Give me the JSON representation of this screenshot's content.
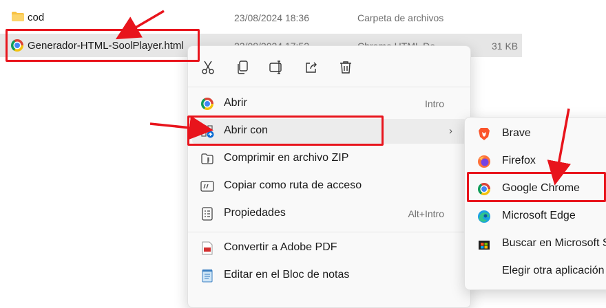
{
  "files": [
    {
      "name": "cod",
      "date": "23/08/2024 18:36",
      "type": "Carpeta de archivos",
      "size": ""
    },
    {
      "name": "Generador-HTML-SoolPlayer.html",
      "date": "23/08/2024 17:52",
      "type": "Chrome HTML Do",
      "size": "31 KB"
    }
  ],
  "context_menu": {
    "toolbar_icons": [
      "cut-icon",
      "copy-icon",
      "rename-icon",
      "share-icon",
      "delete-icon"
    ],
    "items": [
      {
        "label": "Abrir",
        "shortcut": "Intro",
        "icon": "chrome-icon"
      },
      {
        "label": "Abrir con",
        "shortcut": "",
        "icon": "open-with-icon"
      },
      {
        "label": "Comprimir en archivo ZIP",
        "shortcut": "",
        "icon": "zip-icon"
      },
      {
        "label": "Copiar como ruta de acceso",
        "shortcut": "",
        "icon": "path-icon"
      },
      {
        "label": "Propiedades",
        "shortcut": "Alt+Intro",
        "icon": "properties-icon"
      },
      {
        "label": "Convertir a Adobe PDF",
        "shortcut": "",
        "icon": "pdf-icon"
      },
      {
        "label": "Editar en el Bloc de notas",
        "shortcut": "",
        "icon": "notepad-icon"
      }
    ]
  },
  "submenu": {
    "items": [
      {
        "label": "Brave",
        "icon": "brave-icon"
      },
      {
        "label": "Firefox",
        "icon": "firefox-icon"
      },
      {
        "label": "Google Chrome",
        "icon": "chrome-icon"
      },
      {
        "label": "Microsoft Edge",
        "icon": "edge-icon"
      },
      {
        "label": "Buscar en Microsoft Store",
        "icon": "store-icon"
      },
      {
        "label": "Elegir otra aplicación",
        "icon": ""
      }
    ]
  },
  "colors": {
    "highlight": "#e8141c",
    "selection": "#e6e6e6",
    "menu_bg": "#f9f9f9"
  }
}
